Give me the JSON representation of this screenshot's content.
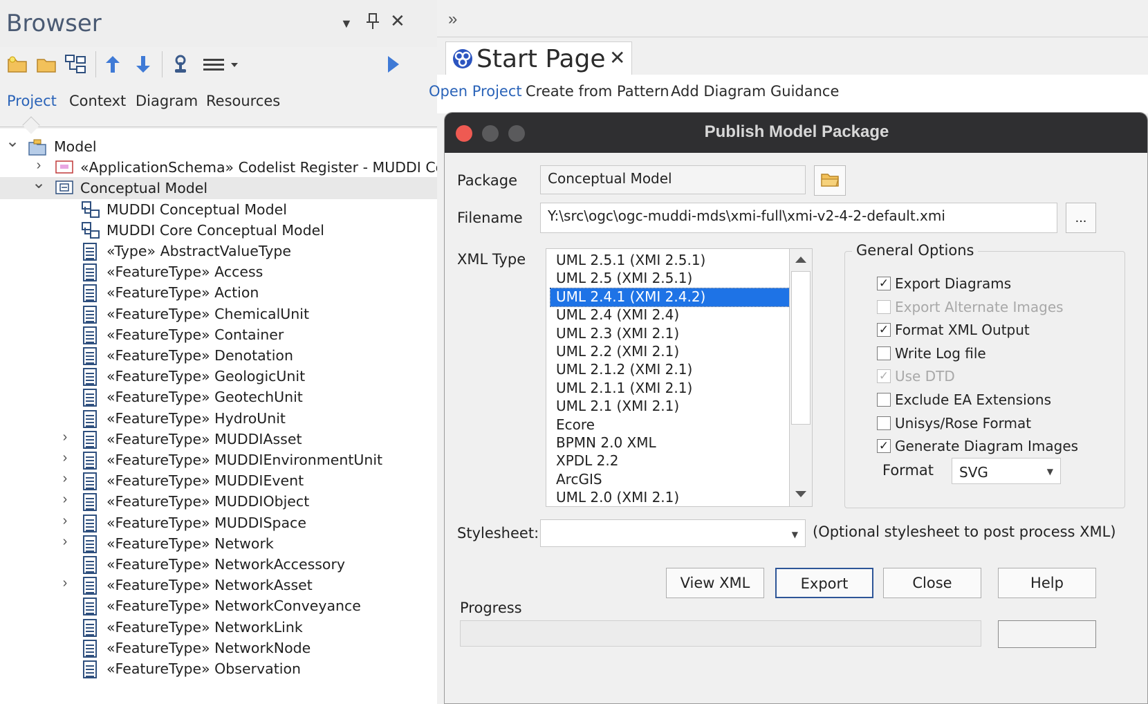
{
  "browser": {
    "title": "Browser",
    "tabs": [
      "Project",
      "Context",
      "Diagram",
      "Resources"
    ],
    "tree": [
      {
        "label": "Model",
        "icon": "package",
        "expander": "expanded",
        "indent": 0
      },
      {
        "label": "«ApplicationSchema» Codelist Register - MUDDI Core",
        "icon": "schema-package",
        "expander": "collapsed",
        "indent": 1
      },
      {
        "label": "Conceptual Model",
        "icon": "package",
        "expander": "expanded",
        "indent": 1,
        "selected": true
      },
      {
        "label": "MUDDI Conceptual Model",
        "icon": "diagram",
        "expander": "none",
        "indent": 2
      },
      {
        "label": "MUDDI Core Conceptual Model",
        "icon": "diagram",
        "expander": "none",
        "indent": 2
      },
      {
        "label": "«Type» AbstractValueType",
        "icon": "class",
        "expander": "none",
        "indent": 2
      },
      {
        "label": "«FeatureType» Access",
        "icon": "class",
        "expander": "none",
        "indent": 2
      },
      {
        "label": "«FeatureType» Action",
        "icon": "class",
        "expander": "none",
        "indent": 2
      },
      {
        "label": "«FeatureType» ChemicalUnit",
        "icon": "class",
        "expander": "none",
        "indent": 2
      },
      {
        "label": "«FeatureType» Container",
        "icon": "class",
        "expander": "none",
        "indent": 2
      },
      {
        "label": "«FeatureType» Denotation",
        "icon": "class",
        "expander": "none",
        "indent": 2
      },
      {
        "label": "«FeatureType» GeologicUnit",
        "icon": "class",
        "expander": "none",
        "indent": 2
      },
      {
        "label": "«FeatureType» GeotechUnit",
        "icon": "class",
        "expander": "none",
        "indent": 2
      },
      {
        "label": "«FeatureType» HydroUnit",
        "icon": "class",
        "expander": "none",
        "indent": 2
      },
      {
        "label": "«FeatureType» MUDDIAsset",
        "icon": "class",
        "expander": "collapsed",
        "indent": 2
      },
      {
        "label": "«FeatureType» MUDDIEnvironmentUnit",
        "icon": "class",
        "expander": "collapsed",
        "indent": 2
      },
      {
        "label": "«FeatureType» MUDDIEvent",
        "icon": "class",
        "expander": "collapsed",
        "indent": 2
      },
      {
        "label": "«FeatureType» MUDDIObject",
        "icon": "class",
        "expander": "collapsed",
        "indent": 2
      },
      {
        "label": "«FeatureType» MUDDISpace",
        "icon": "class",
        "expander": "collapsed",
        "indent": 2
      },
      {
        "label": "«FeatureType» Network",
        "icon": "class",
        "expander": "collapsed",
        "indent": 2
      },
      {
        "label": "«FeatureType» NetworkAccessory",
        "icon": "class",
        "expander": "none",
        "indent": 2
      },
      {
        "label": "«FeatureType» NetworkAsset",
        "icon": "class",
        "expander": "collapsed",
        "indent": 2
      },
      {
        "label": "«FeatureType» NetworkConveyance",
        "icon": "class",
        "expander": "none",
        "indent": 2
      },
      {
        "label": "«FeatureType» NetworkLink",
        "icon": "class",
        "expander": "none",
        "indent": 2
      },
      {
        "label": "«FeatureType» NetworkNode",
        "icon": "class",
        "expander": "none",
        "indent": 2
      },
      {
        "label": "«FeatureType» Observation",
        "icon": "class",
        "expander": "none",
        "indent": 2
      }
    ]
  },
  "start_page": {
    "tab_title": "Start Page",
    "nav": [
      "Open Project",
      "Create from Pattern",
      "Add Diagram",
      "Guidance"
    ]
  },
  "dialog": {
    "title": "Publish Model Package",
    "package_label": "Package",
    "package_value": "Conceptual Model",
    "filename_label": "Filename",
    "filename_value": "Y:\\src\\ogc\\ogc-muddi-mds\\xmi-full\\xmi-v2-4-2-default.xmi",
    "browse_label": "...",
    "xml_type_label": "XML Type",
    "xml_types": [
      "UML 2.5.1 (XMI 2.5.1)",
      "UML 2.5 (XMI 2.5.1)",
      "UML 2.4.1 (XMI 2.4.2)",
      "UML 2.4 (XMI 2.4)",
      "UML 2.3 (XMI 2.1)",
      "UML 2.2 (XMI 2.1)",
      "UML 2.1.2 (XMI 2.1)",
      "UML 2.1.1 (XMI 2.1)",
      "UML 2.1 (XMI 2.1)",
      "Ecore",
      "BPMN 2.0 XML",
      "XPDL 2.2",
      "ArcGIS",
      "UML 2.0 (XMI 2.1)"
    ],
    "xml_type_selected": "UML 2.4.1 (XMI 2.4.2)",
    "general_options_label": "General Options",
    "options": [
      {
        "label": "Export Diagrams",
        "checked": true,
        "enabled": true
      },
      {
        "label": "Export Alternate Images",
        "checked": false,
        "enabled": false
      },
      {
        "label": "Format XML Output",
        "checked": true,
        "enabled": true
      },
      {
        "label": "Write Log file",
        "checked": false,
        "enabled": true
      },
      {
        "label": "Use DTD",
        "checked": true,
        "enabled": false
      },
      {
        "label": "Exclude EA Extensions",
        "checked": false,
        "enabled": true
      },
      {
        "label": "Unisys/Rose Format",
        "checked": false,
        "enabled": true
      },
      {
        "label": "Generate Diagram Images",
        "checked": true,
        "enabled": true
      }
    ],
    "format_label": "Format",
    "format_value": "SVG",
    "stylesheet_label": "Stylesheet:",
    "stylesheet_value": "",
    "stylesheet_hint": "(Optional stylesheet to post process XML)",
    "buttons": {
      "view_xml": "View XML",
      "export": "Export",
      "close": "Close",
      "help": "Help"
    },
    "progress_label": "Progress",
    "progress_value": 0
  },
  "colors": {
    "accent": "#2a63b8",
    "selection": "#1e73e6",
    "dialog_title_bar": "#2f2f31",
    "traffic_close": "#ee5a52",
    "traffic_inactive": "#5a5a5c"
  }
}
